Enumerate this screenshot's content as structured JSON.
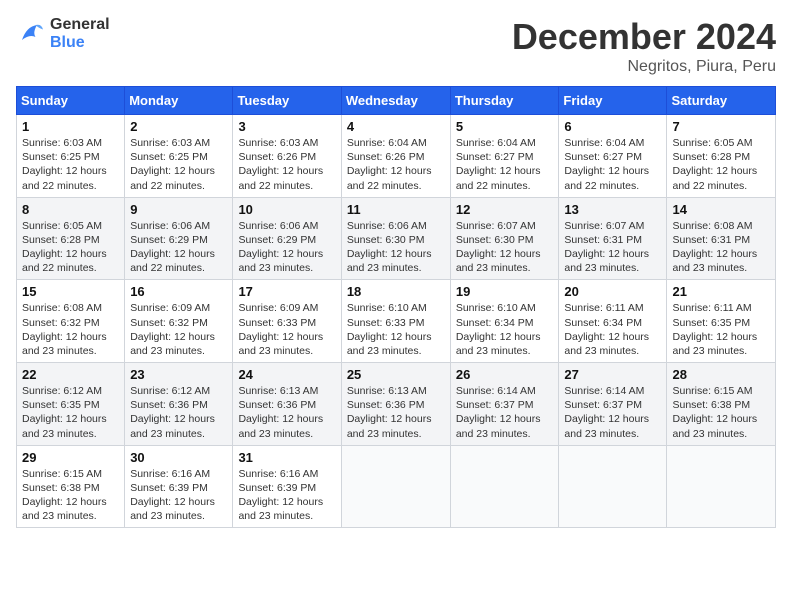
{
  "logo": {
    "line1": "General",
    "line2": "Blue"
  },
  "title": "December 2024",
  "location": "Negritos, Piura, Peru",
  "days_of_week": [
    "Sunday",
    "Monday",
    "Tuesday",
    "Wednesday",
    "Thursday",
    "Friday",
    "Saturday"
  ],
  "weeks": [
    [
      {
        "day": "1",
        "sunrise": "6:03 AM",
        "sunset": "6:25 PM",
        "daylight": "12 hours and 22 minutes."
      },
      {
        "day": "2",
        "sunrise": "6:03 AM",
        "sunset": "6:25 PM",
        "daylight": "12 hours and 22 minutes."
      },
      {
        "day": "3",
        "sunrise": "6:03 AM",
        "sunset": "6:26 PM",
        "daylight": "12 hours and 22 minutes."
      },
      {
        "day": "4",
        "sunrise": "6:04 AM",
        "sunset": "6:26 PM",
        "daylight": "12 hours and 22 minutes."
      },
      {
        "day": "5",
        "sunrise": "6:04 AM",
        "sunset": "6:27 PM",
        "daylight": "12 hours and 22 minutes."
      },
      {
        "day": "6",
        "sunrise": "6:04 AM",
        "sunset": "6:27 PM",
        "daylight": "12 hours and 22 minutes."
      },
      {
        "day": "7",
        "sunrise": "6:05 AM",
        "sunset": "6:28 PM",
        "daylight": "12 hours and 22 minutes."
      }
    ],
    [
      {
        "day": "8",
        "sunrise": "6:05 AM",
        "sunset": "6:28 PM",
        "daylight": "12 hours and 22 minutes."
      },
      {
        "day": "9",
        "sunrise": "6:06 AM",
        "sunset": "6:29 PM",
        "daylight": "12 hours and 22 minutes."
      },
      {
        "day": "10",
        "sunrise": "6:06 AM",
        "sunset": "6:29 PM",
        "daylight": "12 hours and 23 minutes."
      },
      {
        "day": "11",
        "sunrise": "6:06 AM",
        "sunset": "6:30 PM",
        "daylight": "12 hours and 23 minutes."
      },
      {
        "day": "12",
        "sunrise": "6:07 AM",
        "sunset": "6:30 PM",
        "daylight": "12 hours and 23 minutes."
      },
      {
        "day": "13",
        "sunrise": "6:07 AM",
        "sunset": "6:31 PM",
        "daylight": "12 hours and 23 minutes."
      },
      {
        "day": "14",
        "sunrise": "6:08 AM",
        "sunset": "6:31 PM",
        "daylight": "12 hours and 23 minutes."
      }
    ],
    [
      {
        "day": "15",
        "sunrise": "6:08 AM",
        "sunset": "6:32 PM",
        "daylight": "12 hours and 23 minutes."
      },
      {
        "day": "16",
        "sunrise": "6:09 AM",
        "sunset": "6:32 PM",
        "daylight": "12 hours and 23 minutes."
      },
      {
        "day": "17",
        "sunrise": "6:09 AM",
        "sunset": "6:33 PM",
        "daylight": "12 hours and 23 minutes."
      },
      {
        "day": "18",
        "sunrise": "6:10 AM",
        "sunset": "6:33 PM",
        "daylight": "12 hours and 23 minutes."
      },
      {
        "day": "19",
        "sunrise": "6:10 AM",
        "sunset": "6:34 PM",
        "daylight": "12 hours and 23 minutes."
      },
      {
        "day": "20",
        "sunrise": "6:11 AM",
        "sunset": "6:34 PM",
        "daylight": "12 hours and 23 minutes."
      },
      {
        "day": "21",
        "sunrise": "6:11 AM",
        "sunset": "6:35 PM",
        "daylight": "12 hours and 23 minutes."
      }
    ],
    [
      {
        "day": "22",
        "sunrise": "6:12 AM",
        "sunset": "6:35 PM",
        "daylight": "12 hours and 23 minutes."
      },
      {
        "day": "23",
        "sunrise": "6:12 AM",
        "sunset": "6:36 PM",
        "daylight": "12 hours and 23 minutes."
      },
      {
        "day": "24",
        "sunrise": "6:13 AM",
        "sunset": "6:36 PM",
        "daylight": "12 hours and 23 minutes."
      },
      {
        "day": "25",
        "sunrise": "6:13 AM",
        "sunset": "6:36 PM",
        "daylight": "12 hours and 23 minutes."
      },
      {
        "day": "26",
        "sunrise": "6:14 AM",
        "sunset": "6:37 PM",
        "daylight": "12 hours and 23 minutes."
      },
      {
        "day": "27",
        "sunrise": "6:14 AM",
        "sunset": "6:37 PM",
        "daylight": "12 hours and 23 minutes."
      },
      {
        "day": "28",
        "sunrise": "6:15 AM",
        "sunset": "6:38 PM",
        "daylight": "12 hours and 23 minutes."
      }
    ],
    [
      {
        "day": "29",
        "sunrise": "6:15 AM",
        "sunset": "6:38 PM",
        "daylight": "12 hours and 23 minutes."
      },
      {
        "day": "30",
        "sunrise": "6:16 AM",
        "sunset": "6:39 PM",
        "daylight": "12 hours and 23 minutes."
      },
      {
        "day": "31",
        "sunrise": "6:16 AM",
        "sunset": "6:39 PM",
        "daylight": "12 hours and 23 minutes."
      },
      null,
      null,
      null,
      null
    ]
  ],
  "labels": {
    "sunrise": "Sunrise:",
    "sunset": "Sunset:",
    "daylight": "Daylight:"
  }
}
